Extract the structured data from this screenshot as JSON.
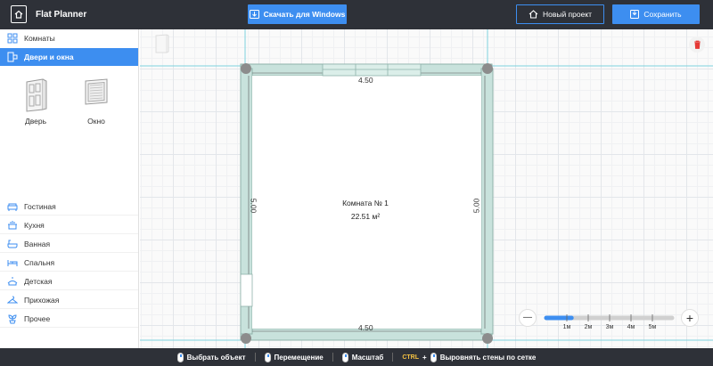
{
  "header": {
    "title": "Flat Planner",
    "download_label": "Скачать для Windows",
    "new_project_label": "Новый проект",
    "save_label": "Сохранить"
  },
  "sidebar": {
    "top_items": [
      {
        "label": "Комнаты",
        "icon": "rooms-icon",
        "active": false
      },
      {
        "label": "Двери и окна",
        "icon": "doors-windows-icon",
        "active": true
      }
    ],
    "tiles": [
      {
        "label": "Дверь",
        "icon": "door-icon"
      },
      {
        "label": "Окно",
        "icon": "window-icon"
      }
    ],
    "categories": [
      {
        "label": "Гостиная",
        "icon": "sofa-icon"
      },
      {
        "label": "Кухня",
        "icon": "kitchen-icon"
      },
      {
        "label": "Ванная",
        "icon": "bathtub-icon"
      },
      {
        "label": "Спальня",
        "icon": "bed-icon"
      },
      {
        "label": "Детская",
        "icon": "kids-icon"
      },
      {
        "label": "Прихожая",
        "icon": "hanger-icon"
      },
      {
        "label": "Прочее",
        "icon": "plant-icon"
      }
    ]
  },
  "room": {
    "name": "Комната №  1",
    "area": "22.51 м²",
    "top_dim": "4.50",
    "bottom_dim": "4.50",
    "left_dim": "5.00",
    "right_dim": "5.00"
  },
  "zoom": {
    "minus": "—",
    "plus": "+",
    "scale_labels": [
      "1м",
      "2м",
      "3м",
      "4м",
      "5м"
    ],
    "level": 0.2
  },
  "footer": {
    "select": "Выбрать объект",
    "move": "Перемещение",
    "scale": "Масштаб",
    "ctrl": "CTRL",
    "plus": "+",
    "align": "Выровнять стены по сетке"
  },
  "colors": {
    "header_bg": "#2e3138",
    "accent": "#3d8ef0",
    "wall": "#c8e2dc",
    "guide": "#7ed3df",
    "delete": "#e53935"
  }
}
